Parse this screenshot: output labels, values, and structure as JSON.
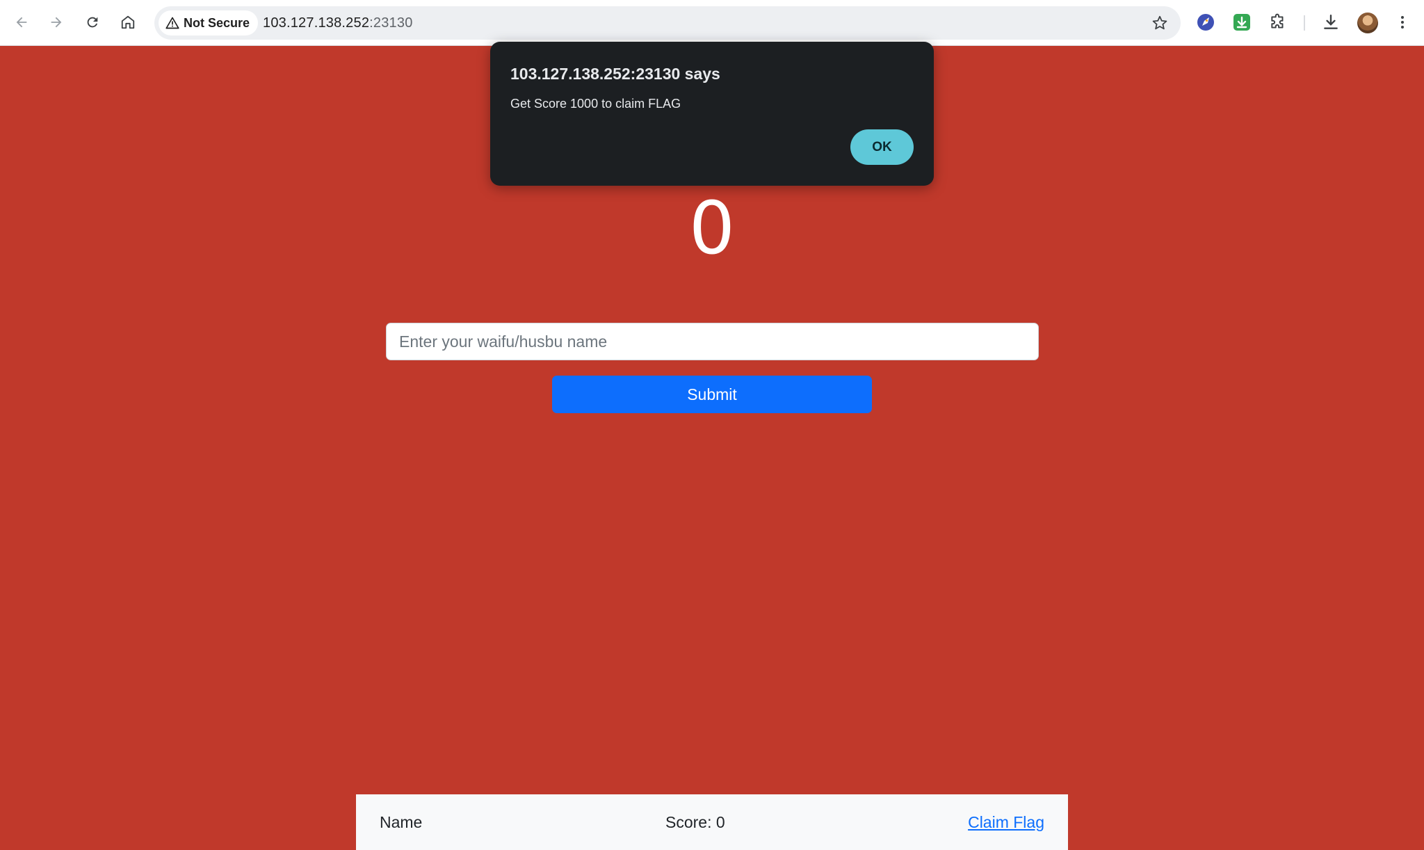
{
  "browser": {
    "security_label": "Not Secure",
    "url_host": "103.127.138.252",
    "url_port": ":23130",
    "icons": {
      "back": "back-arrow-icon",
      "forward": "forward-arrow-icon",
      "reload": "reload-icon",
      "home": "home-icon",
      "warning": "warning-triangle-icon",
      "bookmark": "star-icon",
      "extension_1": "rocket-extension-icon",
      "extension_2": "download-manager-extension-icon",
      "extensions": "puzzle-icon",
      "downloads": "download-icon",
      "menu": "kebab-menu-icon"
    }
  },
  "main": {
    "score": "0",
    "name_input": {
      "placeholder": "Enter your waifu/husbu name",
      "value": ""
    },
    "submit_label": "Submit"
  },
  "footer": {
    "name_label": "Name",
    "score_label": "Score: 0",
    "claim_link": "Claim Flag"
  },
  "alert": {
    "title": "103.127.138.252:23130 says",
    "message": "Get Score 1000 to claim FLAG",
    "ok_label": "OK"
  },
  "colors": {
    "page_background": "#c0392b",
    "submit_button": "#0d6efd",
    "alert_background": "#1c1f22",
    "alert_ok_button": "#5ec8d8"
  }
}
